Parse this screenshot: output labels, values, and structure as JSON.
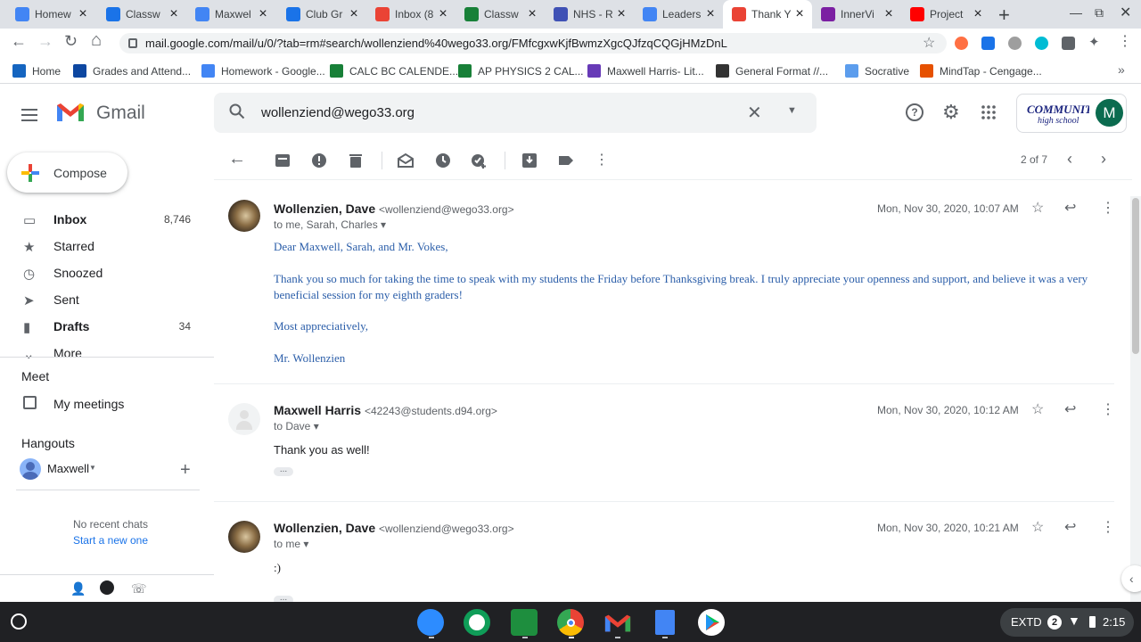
{
  "tabs": [
    {
      "title": "Homew",
      "color": "#4285f4"
    },
    {
      "title": "Classw",
      "color": "#1a73e8"
    },
    {
      "title": "Maxwel",
      "color": "#4285f4"
    },
    {
      "title": "Club Gr",
      "color": "#1a73e8"
    },
    {
      "title": "Inbox (8",
      "color": "#ea4335"
    },
    {
      "title": "Classw",
      "color": "#188038"
    },
    {
      "title": "NHS - R",
      "color": "#3f51b5"
    },
    {
      "title": "Leaders",
      "color": "#4285f4"
    },
    {
      "title": "Thank Y",
      "color": "#ea4335"
    },
    {
      "title": "InnerVi",
      "color": "#7b1fa2"
    },
    {
      "title": "Project",
      "color": "#ff0000"
    }
  ],
  "url": "mail.google.com/mail/u/0/?tab=rm#search/wollenziend%40wego33.org/FMfcgxwKjfBwmzXgcQJfzqCQGjHMzDnL",
  "bookmarks": [
    {
      "label": "Home",
      "color": "#1565c0"
    },
    {
      "label": "Grades and Attend...",
      "color": "#0d47a1"
    },
    {
      "label": "Homework - Google...",
      "color": "#4285f4"
    },
    {
      "label": "CALC BC CALENDE...",
      "color": "#188038"
    },
    {
      "label": "AP PHYSICS 2 CAL...",
      "color": "#188038"
    },
    {
      "label": "Maxwell Harris- Lit...",
      "color": "#673ab7"
    },
    {
      "label": "General Format //...",
      "color": "#333333"
    },
    {
      "label": "Socrative",
      "color": "#5c9ded"
    },
    {
      "label": "MindTap - Cengage...",
      "color": "#e65100"
    }
  ],
  "gmail": {
    "logo": "Gmail",
    "search_value": "wollenziend@wego33.org",
    "avatar_letter": "M",
    "compose": "Compose"
  },
  "sidebar": [
    {
      "label": "Inbox",
      "count": "8,746",
      "bold": true
    },
    {
      "label": "Starred",
      "count": ""
    },
    {
      "label": "Snoozed",
      "count": ""
    },
    {
      "label": "Sent",
      "count": ""
    },
    {
      "label": "Drafts",
      "count": "34",
      "bold": true
    },
    {
      "label": "More",
      "count": ""
    }
  ],
  "meet": {
    "title": "Meet",
    "item": "My meetings"
  },
  "hangouts": {
    "title": "Hangouts",
    "user": "Maxwell",
    "no_chats": "No recent chats",
    "start_new": "Start a new one"
  },
  "pager": "2 of 7",
  "messages": [
    {
      "sender": "Wollenzien, Dave",
      "email": "<wollenziend@wego33.org>",
      "to": "to me, Sarah, Charles",
      "date": "Mon, Nov 30, 2020, 10:07 AM",
      "body": [
        "Dear Maxwell, Sarah, and Mr. Vokes,",
        "Thank you so much for taking the time to speak with my students the Friday before Thanksgiving break.  I truly appreciate your openness and support, and believe it was a very beneficial session for my eighth graders!",
        "Most appreciatively,",
        "Mr. Wollenzien"
      ]
    },
    {
      "sender": "Maxwell Harris",
      "email": "<42243@students.d94.org>",
      "to": "to Dave",
      "date": "Mon, Nov 30, 2020, 10:12 AM",
      "body": [
        "Thank you as well!"
      ]
    },
    {
      "sender": "Wollenzien, Dave",
      "email": "<wollenziend@wego33.org>",
      "to": "to me",
      "date": "Mon, Nov 30, 2020, 10:21 AM",
      "body": [
        ":)"
      ]
    }
  ],
  "shelf": {
    "display": "EXTD",
    "badge": "2",
    "time": "2:15"
  }
}
